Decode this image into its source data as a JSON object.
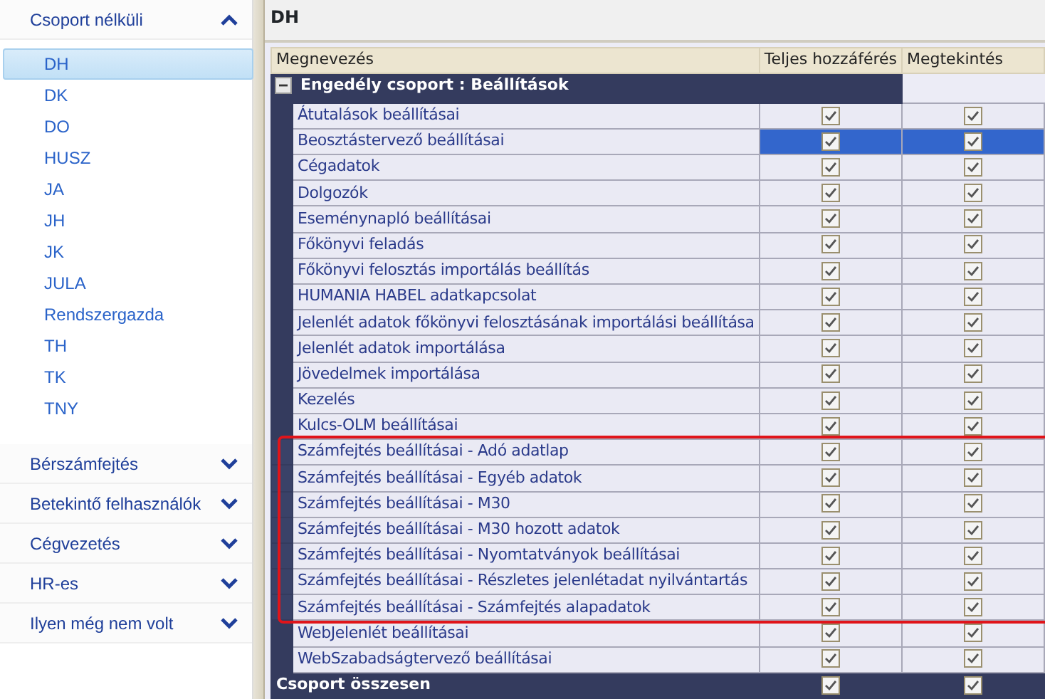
{
  "sidebar": {
    "sections": [
      {
        "title": "Csoport nélküli",
        "expanded": true,
        "items": [
          {
            "label": "DH",
            "selected": true
          },
          {
            "label": "DK",
            "selected": false
          },
          {
            "label": "DO",
            "selected": false
          },
          {
            "label": "HUSZ",
            "selected": false
          },
          {
            "label": "JA",
            "selected": false
          },
          {
            "label": "JH",
            "selected": false
          },
          {
            "label": "JK",
            "selected": false
          },
          {
            "label": "JULA",
            "selected": false
          },
          {
            "label": "Rendszergazda",
            "selected": false
          },
          {
            "label": "TH",
            "selected": false
          },
          {
            "label": "TK",
            "selected": false
          },
          {
            "label": "TNY",
            "selected": false
          }
        ]
      },
      {
        "title": "Bérszámfejtés",
        "expanded": false
      },
      {
        "title": "Betekintő felhasználók",
        "expanded": false
      },
      {
        "title": "Cégvezetés",
        "expanded": false
      },
      {
        "title": "HR-es",
        "expanded": false
      },
      {
        "title": "Ilyen még nem volt",
        "expanded": false
      }
    ]
  },
  "panel": {
    "title": "DH"
  },
  "table": {
    "columns": [
      "Megnevezés",
      "Teljes hozzáférés",
      "Megtekintés"
    ],
    "group": {
      "label": "Engedély csoport : Beállítások",
      "expanded": true
    },
    "rows": [
      {
        "name": "Átutalások beállításai",
        "full": true,
        "view": true,
        "selected": false,
        "highlighted": false
      },
      {
        "name": "Beosztástervező beállításai",
        "full": true,
        "view": true,
        "selected": true,
        "highlighted": false
      },
      {
        "name": "Cégadatok",
        "full": true,
        "view": true,
        "selected": false,
        "highlighted": false
      },
      {
        "name": "Dolgozók",
        "full": true,
        "view": true,
        "selected": false,
        "highlighted": false
      },
      {
        "name": "Eseménynapló beállításai",
        "full": true,
        "view": true,
        "selected": false,
        "highlighted": false
      },
      {
        "name": "Főkönyvi feladás",
        "full": true,
        "view": true,
        "selected": false,
        "highlighted": false
      },
      {
        "name": "Főkönyvi felosztás importálás beállítás",
        "full": true,
        "view": true,
        "selected": false,
        "highlighted": false
      },
      {
        "name": "HUMANIA HABEL adatkapcsolat",
        "full": true,
        "view": true,
        "selected": false,
        "highlighted": false
      },
      {
        "name": "Jelenlét adatok főkönyvi felosztásának importálási beállítása",
        "full": true,
        "view": true,
        "selected": false,
        "highlighted": false
      },
      {
        "name": "Jelenlét adatok importálása",
        "full": true,
        "view": true,
        "selected": false,
        "highlighted": false
      },
      {
        "name": "Jövedelmek importálása",
        "full": true,
        "view": true,
        "selected": false,
        "highlighted": false
      },
      {
        "name": "Kezelés",
        "full": true,
        "view": true,
        "selected": false,
        "highlighted": false
      },
      {
        "name": "Kulcs-OLM beállításai",
        "full": true,
        "view": true,
        "selected": false,
        "highlighted": false
      },
      {
        "name": "Számfejtés beállításai - Adó adatlap",
        "full": true,
        "view": true,
        "selected": false,
        "highlighted": true
      },
      {
        "name": "Számfejtés beállításai - Egyéb adatok",
        "full": true,
        "view": true,
        "selected": false,
        "highlighted": true
      },
      {
        "name": "Számfejtés beállításai - M30",
        "full": true,
        "view": true,
        "selected": false,
        "highlighted": true
      },
      {
        "name": "Számfejtés beállításai - M30 hozott adatok",
        "full": true,
        "view": true,
        "selected": false,
        "highlighted": true
      },
      {
        "name": "Számfejtés beállításai - Nyomtatványok beállításai",
        "full": true,
        "view": true,
        "selected": false,
        "highlighted": true
      },
      {
        "name": "Számfejtés beállításai - Részletes jelenlétadat nyilvántartás",
        "full": true,
        "view": true,
        "selected": false,
        "highlighted": true
      },
      {
        "name": "Számfejtés beállításai - Számfejtés alapadatok",
        "full": true,
        "view": true,
        "selected": false,
        "highlighted": true
      },
      {
        "name": "WebJelenlét beállításai",
        "full": true,
        "view": true,
        "selected": false,
        "highlighted": false
      },
      {
        "name": "WebSzabadságtervező beállításai",
        "full": true,
        "view": true,
        "selected": false,
        "highlighted": false
      }
    ],
    "total": {
      "label": "Csoport összesen",
      "full": true,
      "view": true
    }
  }
}
